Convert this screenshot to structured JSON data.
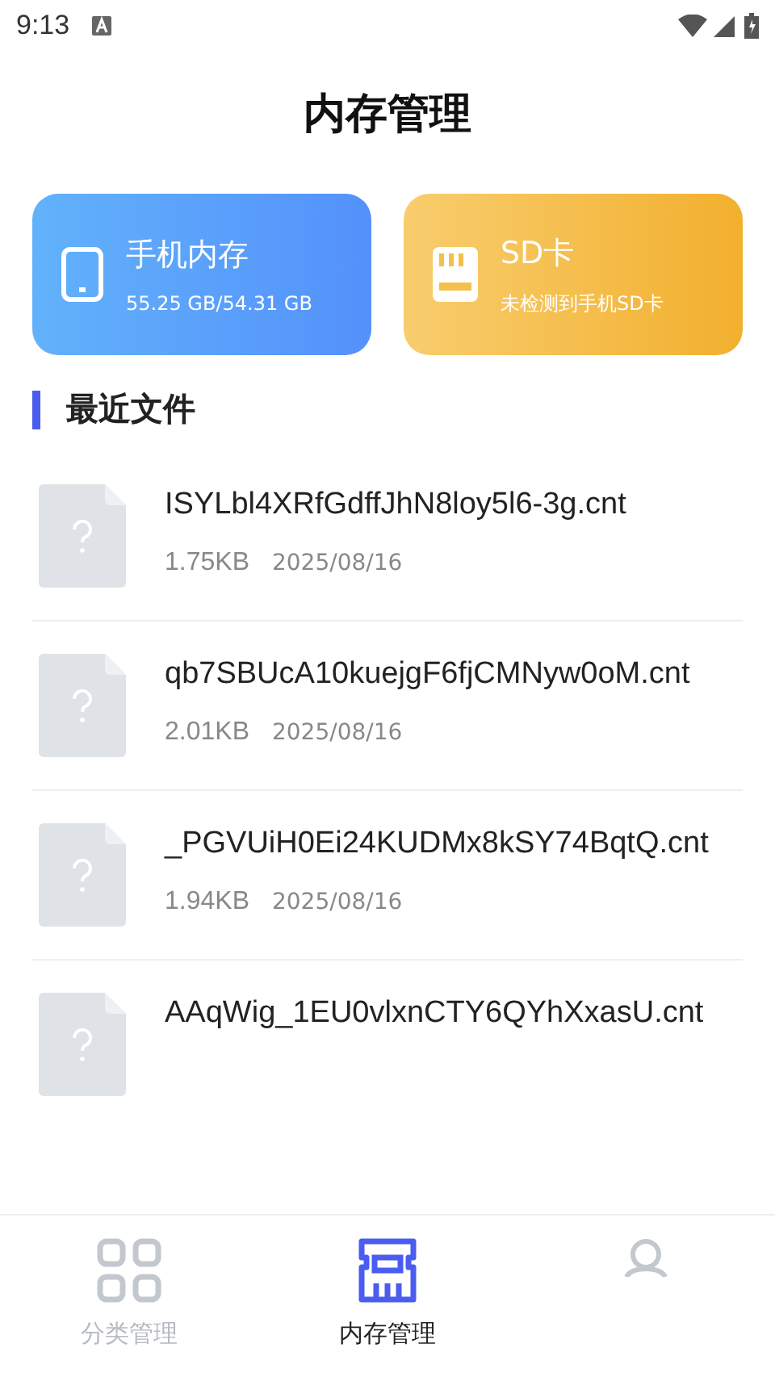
{
  "status_bar": {
    "time": "9:13"
  },
  "title": "内存管理",
  "storage_cards": [
    {
      "kind": "phone",
      "title": "手机内存",
      "detail": "55.25 GB/54.31 GB"
    },
    {
      "kind": "sd",
      "title": "SD卡",
      "detail": "未检测到手机SD卡"
    }
  ],
  "section_title": "最近文件",
  "files": [
    {
      "name": "ISYLbl4XRfGdffJhN8loy5l6-3g.cnt",
      "size": "1.75KB",
      "date": "2025/08/16"
    },
    {
      "name": "qb7SBUcA10kuejgF6fjCMNyw0oM.cnt",
      "size": "2.01KB",
      "date": "2025/08/16"
    },
    {
      "name": "_PGVUiH0Ei24KUDMx8kSY74BqtQ.cnt",
      "size": "1.94KB",
      "date": "2025/08/16"
    },
    {
      "name": "AAqWig_1EU0vlxnCTY6QYhXxasU.cnt"
    }
  ],
  "nav": [
    {
      "kind": "grid",
      "label": "分类管理",
      "selected": false
    },
    {
      "kind": "memory",
      "label": "内存管理",
      "selected": true
    },
    {
      "kind": "user",
      "selected": false
    }
  ]
}
